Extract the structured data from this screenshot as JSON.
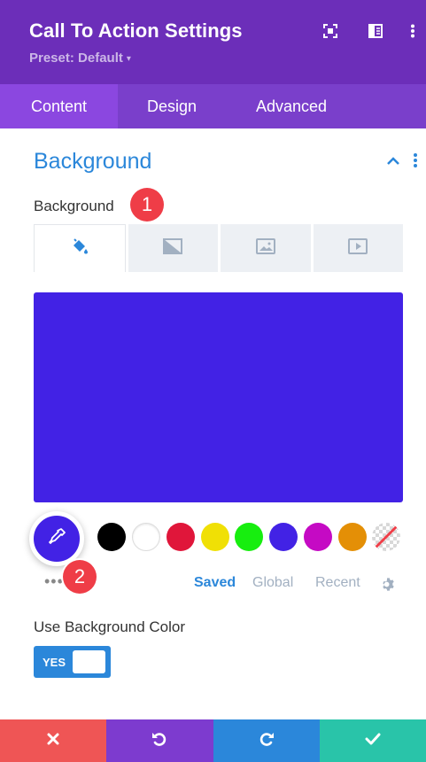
{
  "header": {
    "title": "Call To Action Settings",
    "preset": "Preset: Default",
    "caret": "▾",
    "icons": [
      "expand-icon",
      "sidebar-layout-icon",
      "more-vertical-icon"
    ],
    "background_color": "#6c2eb9"
  },
  "tabs": [
    {
      "label": "Content",
      "active": true
    },
    {
      "label": "Design",
      "active": false
    },
    {
      "label": "Advanced",
      "active": false
    }
  ],
  "section": {
    "title": "Background",
    "field_label": "Background",
    "badge_1": "1",
    "badge_2": "2",
    "bg_type_tabs": [
      {
        "icon": "paint-bucket-icon",
        "active": true
      },
      {
        "icon": "gradient-icon",
        "active": false
      },
      {
        "icon": "image-icon",
        "active": false
      },
      {
        "icon": "video-icon",
        "active": false
      }
    ],
    "preview_color": "#4222e5"
  },
  "palette": {
    "picker_color": "#4222e5",
    "swatches": [
      "#000000",
      "#ffffff",
      "#e0163a",
      "#f0e005",
      "#17ee0f",
      "#4222e5",
      "#c50ac4",
      "#e48f06",
      "transparent"
    ],
    "ellipsis": "•••",
    "tabs": [
      {
        "label": "Saved",
        "active": true
      },
      {
        "label": "Global",
        "active": false
      },
      {
        "label": "Recent",
        "active": false
      }
    ],
    "accent": "#2b87da"
  },
  "use_bg_color": {
    "label": "Use Background Color",
    "toggle_text": "YES",
    "value": true
  },
  "footer": {
    "buttons": [
      {
        "icon": "close-icon",
        "color": "#ef5555"
      },
      {
        "icon": "undo-icon",
        "color": "#7d3bcf"
      },
      {
        "icon": "redo-icon",
        "color": "#2b87da"
      },
      {
        "icon": "check-icon",
        "color": "#29c4a9"
      }
    ]
  }
}
